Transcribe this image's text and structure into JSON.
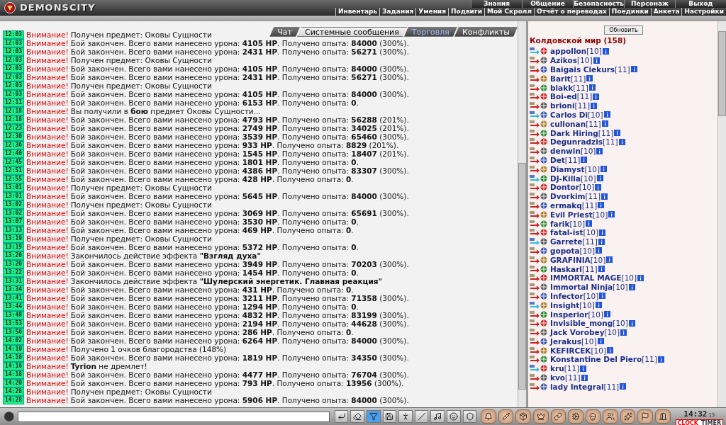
{
  "header": {
    "logo": "DEMONSCITY",
    "main_menu": [
      {
        "label": "Знания"
      },
      {
        "label": "Общение"
      },
      {
        "label": "Безопасность"
      },
      {
        "label": "Персонаж"
      },
      {
        "label": "Выход"
      }
    ],
    "sub_menu": [
      {
        "label": "Инвентарь"
      },
      {
        "label": "Задания"
      },
      {
        "label": "Умения"
      },
      {
        "label": "Подвиги"
      },
      {
        "label": "Мой Скролл"
      },
      {
        "label": "Отчёт о переводах"
      },
      {
        "label": "Поединки"
      },
      {
        "label": "Анкета"
      },
      {
        "label": "Настройки"
      }
    ]
  },
  "chat_tabs": [
    {
      "label": "Чат",
      "selected": false,
      "unread": false
    },
    {
      "label": "Системные сообщения",
      "selected": true,
      "unread": false
    },
    {
      "label": "Торговля",
      "selected": false,
      "unread": true
    },
    {
      "label": "Конфликты",
      "selected": false,
      "unread": false
    }
  ],
  "log": [
    {
      "time": "12:03",
      "label": "Внимание!",
      "text": "Получен предмет: Оковы Сущности"
    },
    {
      "time": "12:03",
      "label": "Внимание!",
      "text": "Бой закончен. Всего вами нанесено урона: **4105 HP**. Получено опыта: **84000** (300%)."
    },
    {
      "time": "12:03",
      "label": "Внимание!",
      "text": "Бой закончен. Всего вами нанесено урона: **2431 HP**. Получено опыта: **56271** (300%)."
    },
    {
      "time": "12:03",
      "label": "Внимание!",
      "text": "Получен предмет: Оковы Сущности"
    },
    {
      "time": "12:03",
      "label": "Внимание!",
      "text": "Бой закончен. Всего вами нанесено урона: **4105 HP**. Получено опыта: **84000** (300%)."
    },
    {
      "time": "12:03",
      "label": "Внимание!",
      "text": "Бой закончен. Всего вами нанесено урона: **2431 HP**. Получено опыта: **56271** (300%)."
    },
    {
      "time": "12:03",
      "label": "Внимание!",
      "text": "Получен предмет: Оковы Сущности"
    },
    {
      "time": "12:03",
      "label": "Внимание!",
      "text": "Бой закончен. Всего вами нанесено урона: **4105 HP**. Получено опыта: **84000** (300%)."
    },
    {
      "time": "12:11",
      "label": "Внимание!",
      "text": "Бой закончен. Всего вами нанесено урона: **6153 HP**. Получено опыта: **0**."
    },
    {
      "time": "12:18",
      "label": "Внимание!",
      "text": "Вы получили в **бою** предмет Оковы Сущности..."
    },
    {
      "time": "12:18",
      "label": "Внимание!",
      "text": "Бой закончен. Всего вами нанесено урона: **4793 HP**. Получено опыта: **56288** (201%)."
    },
    {
      "time": "12:23",
      "label": "Внимание!",
      "text": "Бой закончен. Всего вами нанесено урона: **2749 HP**. Получено опыта: **34025** (201%)."
    },
    {
      "time": "12:30",
      "label": "Внимание!",
      "text": "Бой закончен. Всего вами нанесено урона: **3539 HP**. Получено опыта: **65460** (300%)."
    },
    {
      "time": "12:36",
      "label": "Внимание!",
      "text": "Бой закончен. Всего вами нанесено урона: **933 HP**. Получено опыта: **8829** (201%)."
    },
    {
      "time": "12:40",
      "label": "Внимание!",
      "text": "Бой закончен. Всего вами нанесено урона: **1545 HP**. Получено опыта: **18407** (201%)."
    },
    {
      "time": "12:45",
      "label": "Внимание!",
      "text": "Бой закончен. Всего вами нанесено урона: **1801 HP**. Получено опыта: **0**."
    },
    {
      "time": "12:51",
      "label": "Внимание!",
      "text": "Бой закончен. Всего вами нанесено урона: **4386 HP**. Получено опыта: **83307** (300%)."
    },
    {
      "time": "12:55",
      "label": "Внимание!",
      "text": "Бой закончен. Всего вами нанесено урона: **428 HP**. Получено опыта: **0**."
    },
    {
      "time": "13:01",
      "label": "Внимание!",
      "text": "Получен предмет: Оковы Сущности"
    },
    {
      "time": "13:01",
      "label": "Внимание!",
      "text": "Бой закончен. Всего вами нанесено урона: **5645 HP**. Получено опыта: **84000** (300%)."
    },
    {
      "time": "13:02",
      "label": "Внимание!",
      "text": "Получен предмет: Оковы Сущности"
    },
    {
      "time": "13:02",
      "label": "Внимание!",
      "text": "Бой закончен. Всего вами нанесено урона: **3069 HP**. Получено опыта: **65691** (300%)."
    },
    {
      "time": "13:07",
      "label": "Внимание!",
      "text": "Бой закончен. Всего вами нанесено урона: **3530 HP**. Получено опыта: **0**."
    },
    {
      "time": "13:13",
      "label": "Внимание!",
      "text": "Бой закончен. Всего вами нанесено урона: **469 HP**. Получено опыта: **0**."
    },
    {
      "time": "13:19",
      "label": "Внимание!",
      "text": "Получен предмет: Оковы Сущности"
    },
    {
      "time": "13:19",
      "label": "Внимание!",
      "text": "Бой закончен. Всего вами нанесено урона: **5372 HP**. Получено опыта: **0**."
    },
    {
      "time": "13:20",
      "label": "Внимание!",
      "text": "Закончилось действие эффекта **\"Взгляд духа\"**"
    },
    {
      "time": "13:20",
      "label": "Внимание!",
      "text": "Бой закончен. Всего вами нанесено урона: **3949 HP**. Получено опыта: **70203** (300%)."
    },
    {
      "time": "13:22",
      "label": "Внимание!",
      "text": "Бой закончен. Всего вами нанесено урона: **1454 HP**. Получено опыта: **0**."
    },
    {
      "time": "13:31",
      "label": "Внимание!",
      "text": "Закончилось действие эффекта **\"Шулерский энергетик. Главная реакция\"**"
    },
    {
      "time": "13:34",
      "label": "Внимание!",
      "text": "Бой закончен. Всего вами нанесено урона: **431 HP**. Получено опыта: **0**."
    },
    {
      "time": "13:41",
      "label": "Внимание!",
      "text": "Бой закончен. Всего вами нанесено урона: **3211 HP**. Получено опыта: **71358** (300%)."
    },
    {
      "time": "13:44",
      "label": "Внимание!",
      "text": "Бой закончен. Всего вами нанесено урона: **1294 HP**. Получено опыта: **0**."
    },
    {
      "time": "13:48",
      "label": "Внимание!",
      "text": "Бой закончен. Всего вами нанесено урона: **4832 HP**. Получено опыта: **83199** (300%)."
    },
    {
      "time": "13:53",
      "label": "Внимание!",
      "text": "Бой закончен. Всего вами нанесено урона: **2194 HP**. Получено опыта: **44628** (300%)."
    },
    {
      "time": "13:56",
      "label": "Внимание!",
      "text": "Бой закончен. Всего вами нанесено урона: **286 HP**. Получено опыта: **0**."
    },
    {
      "time": "14:02",
      "label": "Внимание!",
      "text": "Бой закончен. Всего вами нанесено урона: **6264 HP**. Получено опыта: **84000** (300%)."
    },
    {
      "time": "14:10",
      "label": "Внимание!",
      "text": "Получено 1 очков благородства (148%)"
    },
    {
      "time": "14:10",
      "label": "Внимание!",
      "text": "Бой закончен. Всего вами нанесено урона: **1819 HP**. Получено опыта: **34350** (300%)."
    },
    {
      "time": "14:16",
      "label": "Внимание!",
      "text": "**Tyrion** не дремлет!"
    },
    {
      "time": "14:18",
      "label": "Внимание!",
      "text": "Бой закончен. Всего вами нанесено урона: **4477 HP**. Получено опыта: **76704** (300%)."
    },
    {
      "time": "14:20",
      "label": "Внимание!",
      "text": "Бой закончен. Всего вами нанесено урона: **793 HP**. Получено опыта: **13956** (300%)."
    },
    {
      "time": "14:28",
      "label": "Внимание!",
      "text": "Получен предмет: Оковы Сущности"
    },
    {
      "time": "14:28",
      "label": "Внимание!",
      "text": "Бой закончен. Всего вами нанесено урона: **5906 HP**. Получено опыта: **84000** (300%)."
    }
  ],
  "online": {
    "refresh_button": "Обновить",
    "title": "Колдовской мир (158)",
    "users": [
      {
        "name": "appollon",
        "level": "[10]"
      },
      {
        "name": "Azikos",
        "level": "[10]"
      },
      {
        "name": "Baigais Ciekurs",
        "level": "[11]"
      },
      {
        "name": "Barit",
        "level": "[11]"
      },
      {
        "name": "blakk",
        "level": "[11]"
      },
      {
        "name": "Boi-ed",
        "level": "[11]"
      },
      {
        "name": "brioni",
        "level": "[11]"
      },
      {
        "name": "Carlos Di",
        "level": "[10]"
      },
      {
        "name": "cullonan",
        "level": "[11]"
      },
      {
        "name": "Dark Hiring",
        "level": "[11]"
      },
      {
        "name": "Degunradzis",
        "level": "[11]"
      },
      {
        "name": "denwin",
        "level": "[10]"
      },
      {
        "name": "Det",
        "level": "[11]"
      },
      {
        "name": "Diamyst",
        "level": "[10]"
      },
      {
        "name": "DJ-Killa",
        "level": "[10]"
      },
      {
        "name": "Dontor",
        "level": "[10]"
      },
      {
        "name": "Dvorkim",
        "level": "[11]"
      },
      {
        "name": "ermakq",
        "level": "[11]"
      },
      {
        "name": "Evil Priest",
        "level": "[10]"
      },
      {
        "name": "farik",
        "level": "[10]"
      },
      {
        "name": "fatal-ist",
        "level": "[10]"
      },
      {
        "name": "Garrete",
        "level": "[11]"
      },
      {
        "name": "gopota",
        "level": "[10]"
      },
      {
        "name": "GRAFINIA",
        "level": "[10]"
      },
      {
        "name": "Haskarl",
        "level": "[11]"
      },
      {
        "name": "IMMORTAL MAGE",
        "level": "[10]"
      },
      {
        "name": "Immortal Ninja",
        "level": "[10]"
      },
      {
        "name": "Infector",
        "level": "[10]"
      },
      {
        "name": "Insight",
        "level": "[10]"
      },
      {
        "name": "Insperior",
        "level": "[10]"
      },
      {
        "name": "Invisible_mong",
        "level": "[10]"
      },
      {
        "name": "Jack Vorobey",
        "level": "[10]"
      },
      {
        "name": "Jerakus",
        "level": "[10]"
      },
      {
        "name": "KEFIRCEK",
        "level": "[10]"
      },
      {
        "name": "Konstantine Del Piero",
        "level": "[11]"
      },
      {
        "name": "kru",
        "level": "[11]"
      },
      {
        "name": "kvo",
        "level": "[11]"
      },
      {
        "name": "lady Integral",
        "level": "[11]"
      }
    ]
  },
  "toolbar": [
    {
      "kind": "enter",
      "pressed": false
    },
    {
      "kind": "eraser",
      "pressed": false
    },
    {
      "kind": "filter",
      "pressed": true
    },
    {
      "kind": "save",
      "pressed": false
    },
    {
      "kind": "walk",
      "pressed": false
    },
    {
      "kind": "slash",
      "pressed": false
    },
    {
      "kind": "music",
      "pressed": false
    },
    {
      "kind": "smile",
      "pressed": false
    },
    {
      "kind": "shield",
      "pressed": false
    }
  ],
  "clock": {
    "time": "14:32",
    "seconds": "13",
    "clock_label": "CLOCK",
    "timer_label": "TIMER"
  }
}
